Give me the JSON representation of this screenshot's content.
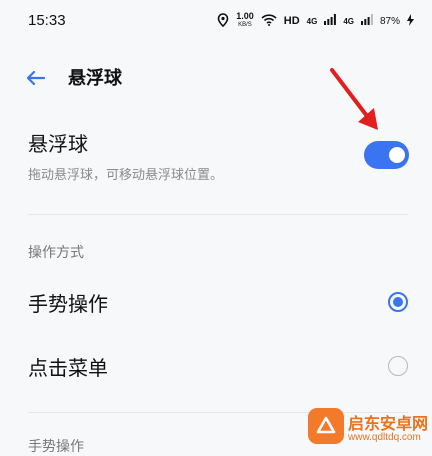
{
  "status_bar": {
    "time": "15:33",
    "net_speed": "1.00",
    "net_speed_unit": "KB/S",
    "hd_label": "HD",
    "signal1": "4G",
    "signal2": "4G",
    "battery": "87%"
  },
  "app_bar": {
    "title": "悬浮球"
  },
  "floating_ball": {
    "title": "悬浮球",
    "subtitle": "拖动悬浮球，可移动悬浮球位置。",
    "enabled": true
  },
  "operation_mode": {
    "header": "操作方式",
    "options": [
      {
        "label": "手势操作",
        "selected": true
      },
      {
        "label": "点击菜单",
        "selected": false
      }
    ]
  },
  "next_section": {
    "header": "手势操作"
  },
  "watermark": {
    "title": "启东安卓网",
    "url": "www.qdltdq.com"
  },
  "colors": {
    "accent": "#3a74f0",
    "annotation_arrow": "#e02020",
    "watermark": "#e8731f"
  }
}
